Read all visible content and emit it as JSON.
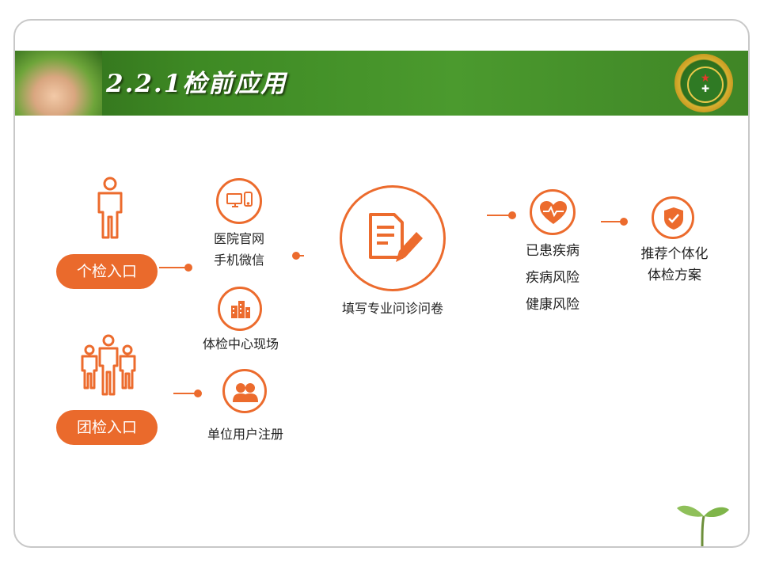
{
  "slide": {
    "title": "2.2.1检前应用",
    "entries": {
      "individual": "个检入口",
      "group": "团检入口"
    },
    "channels": {
      "online": [
        "医院官网",
        "手机微信"
      ],
      "onsite": "体检中心现场",
      "unit": "单位用户注册"
    },
    "questionnaire": "填写专业问诊问卷",
    "risks": [
      "已患疾病",
      "疾病风险",
      "健康风险"
    ],
    "recommendation": [
      "推荐个体化",
      "体检方案"
    ]
  },
  "colors": {
    "accent": "#ec6b2d",
    "banner_green": "#3e8a24",
    "border": "#c8c8c8"
  },
  "icons": {
    "individual": "person-icon",
    "group": "group-icon",
    "online": "devices-icon",
    "onsite": "building-icon",
    "unit": "users-icon",
    "questionnaire": "document-pen-icon",
    "risks": "heart-pulse-icon",
    "recommendation": "shield-check-icon"
  }
}
